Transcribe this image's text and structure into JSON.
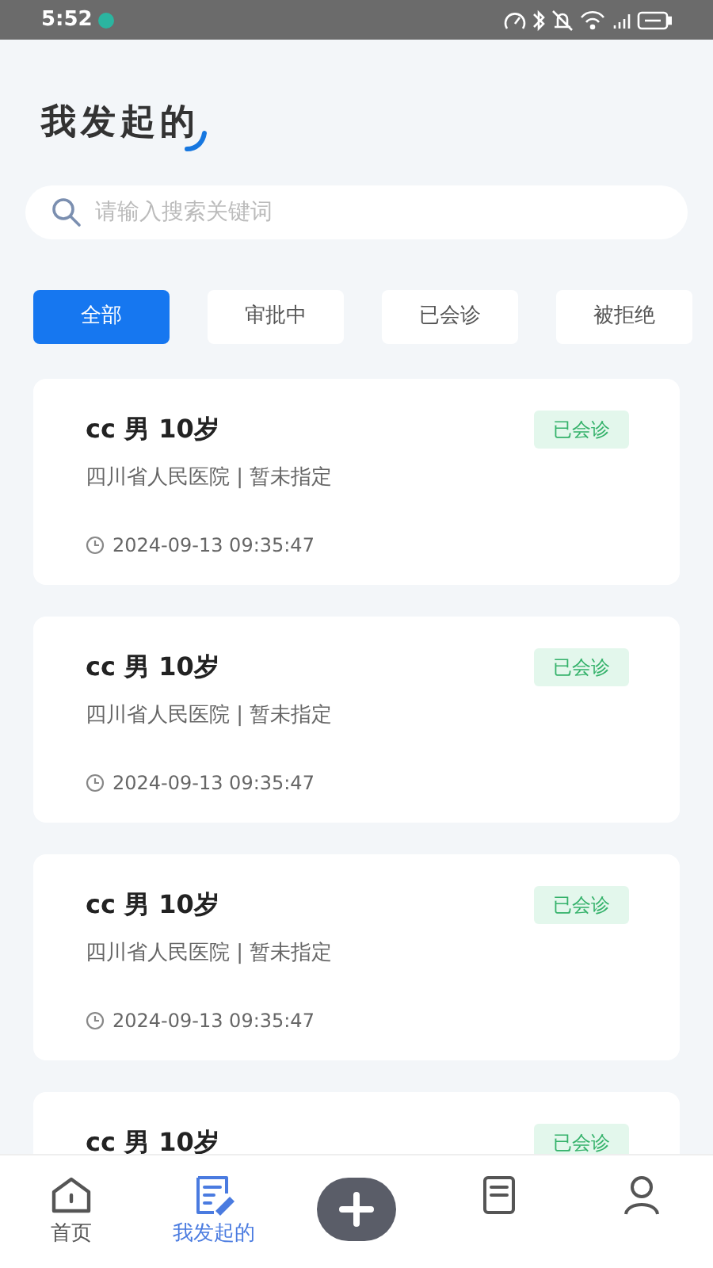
{
  "status_bar": {
    "time": "5:52"
  },
  "title": "我发起的",
  "search": {
    "placeholder": "请输入搜索关键词"
  },
  "tabs": [
    {
      "label": "全部",
      "selected": true
    },
    {
      "label": "审批中",
      "selected": false
    },
    {
      "label": "已会诊",
      "selected": false
    },
    {
      "label": "被拒绝",
      "selected": false
    }
  ],
  "cards": [
    {
      "patient": "cc 男 10岁",
      "hospital": "四川省人民医院 | 暂未指定",
      "time": "2024-09-13 09:35:47",
      "status": "已会诊"
    },
    {
      "patient": "cc 男 10岁",
      "hospital": "四川省人民医院 | 暂未指定",
      "time": "2024-09-13 09:35:47",
      "status": "已会诊"
    },
    {
      "patient": "cc 男 10岁",
      "hospital": "四川省人民医院 | 暂未指定",
      "time": "2024-09-13 09:35:47",
      "status": "已会诊"
    },
    {
      "patient": "cc 男 10岁",
      "status": "已会诊"
    }
  ],
  "nav": [
    {
      "kind": "home",
      "label": "首页",
      "selected": false
    },
    {
      "kind": "edit",
      "label": "我发起的",
      "selected": true
    },
    {
      "kind": "add"
    },
    {
      "kind": "doc",
      "selected": false
    },
    {
      "kind": "user",
      "selected": false
    }
  ]
}
